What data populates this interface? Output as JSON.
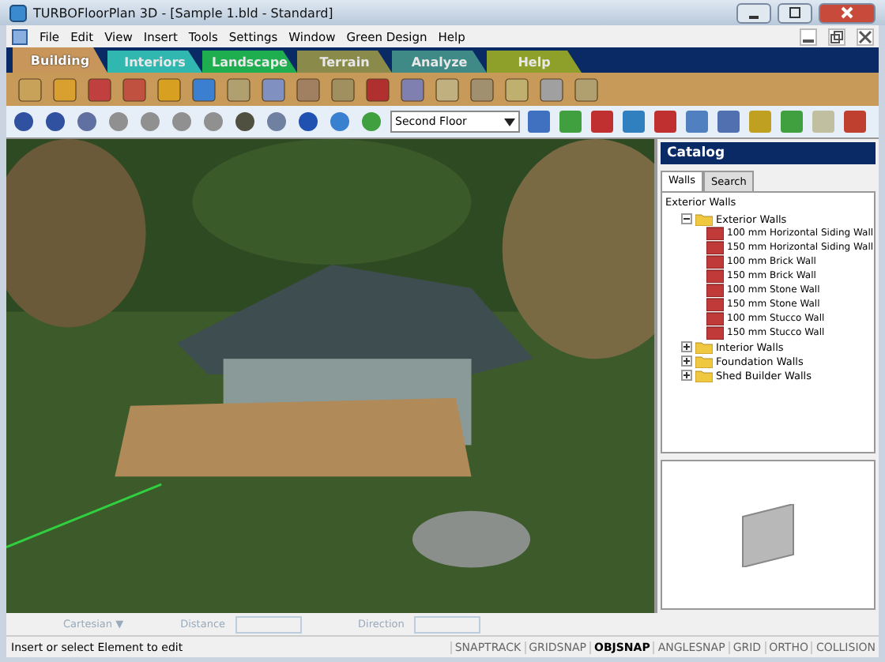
{
  "window": {
    "title": "TURBOFloorPlan 3D - [Sample 1.bld - Standard]"
  },
  "menu": [
    "File",
    "Edit",
    "View",
    "Insert",
    "Tools",
    "Settings",
    "Window",
    "Green Design",
    "Help"
  ],
  "ribbon_tabs": [
    {
      "label": "Building",
      "selected": true,
      "color": "#c8965a"
    },
    {
      "label": "Interiors",
      "selected": false,
      "color": "#2fb7b0"
    },
    {
      "label": "Landscape",
      "selected": false,
      "color": "#1fae4f"
    },
    {
      "label": "Terrain",
      "selected": false,
      "color": "#8a8a4a"
    },
    {
      "label": "Analyze",
      "selected": false,
      "color": "#3f8a86"
    },
    {
      "label": "Help",
      "selected": false,
      "color": "#8fa02a"
    }
  ],
  "floor_select": {
    "value": "Second Floor"
  },
  "catalog": {
    "title": "Catalog",
    "tabs": [
      {
        "label": "Walls",
        "selected": true
      },
      {
        "label": "Search",
        "selected": false
      }
    ],
    "heading": "Exterior Walls",
    "tree": [
      {
        "label": "Exterior Walls",
        "expanded": true,
        "children": [
          {
            "label": "100 mm Horizontal Siding Wall"
          },
          {
            "label": "150 mm Horizontal Siding Wall"
          },
          {
            "label": "100 mm Brick Wall"
          },
          {
            "label": "150 mm Brick Wall"
          },
          {
            "label": "100 mm Stone Wall"
          },
          {
            "label": "150 mm Stone Wall"
          },
          {
            "label": "100 mm Stucco Wall"
          },
          {
            "label": "150 mm Stucco Wall"
          }
        ]
      },
      {
        "label": "Interior Walls",
        "expanded": false
      },
      {
        "label": "Foundation Walls",
        "expanded": false
      },
      {
        "label": "Shed Builder Walls",
        "expanded": false
      }
    ]
  },
  "coord_bar": {
    "mode": "Cartesian",
    "mode_arrow": "▼",
    "distance_label": "Distance",
    "direction_label": "Direction"
  },
  "status_bar": {
    "message": "Insert or select Element to edit",
    "toggles": [
      {
        "label": "SNAPTRACK",
        "on": false
      },
      {
        "label": "GRIDSNAP",
        "on": false
      },
      {
        "label": "OBJSNAP",
        "on": true
      },
      {
        "label": "ANGLESNAP",
        "on": false
      },
      {
        "label": "GRID",
        "on": false
      },
      {
        "label": "ORTHO",
        "on": false
      },
      {
        "label": "COLLISION",
        "on": false
      }
    ]
  }
}
